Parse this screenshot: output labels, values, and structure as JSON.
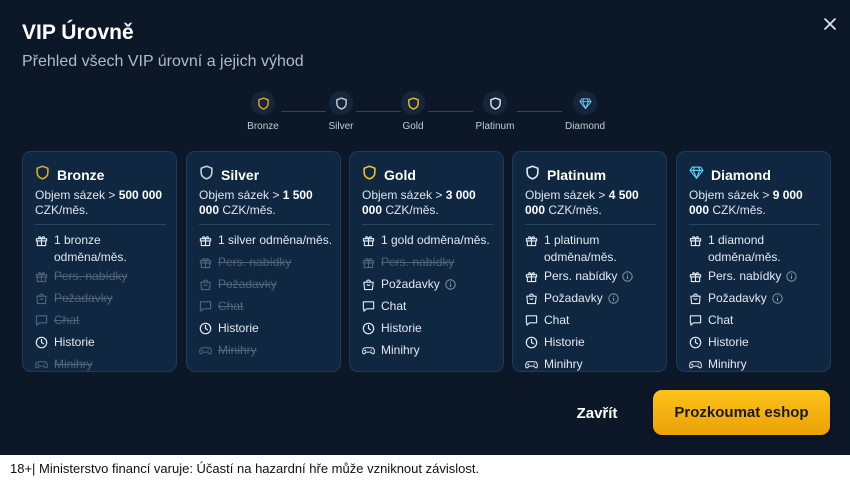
{
  "modal": {
    "title": "VIP Úrovně",
    "subtitle": "Přehled všech VIP úrovní a jejich výhod",
    "close_icon": "close-icon"
  },
  "stepper": [
    {
      "label": "Bronze",
      "icon": "shield-icon",
      "color": "#e0a526"
    },
    {
      "label": "Silver",
      "icon": "shield-icon",
      "color": "#c9ced6"
    },
    {
      "label": "Gold",
      "icon": "shield-icon",
      "color": "#f2c21b"
    },
    {
      "label": "Platinum",
      "icon": "shield-icon",
      "color": "#e3e7ec"
    },
    {
      "label": "Diamond",
      "icon": "diamond-icon",
      "color": "#5ec8f2"
    }
  ],
  "tiers": [
    {
      "name": "Bronze",
      "icon": "shield-icon",
      "color": "#e0a526",
      "req_prefix": "Objem sázek > ",
      "req_value": "500 000",
      "req_suffix": " CZK/měs.",
      "features": [
        {
          "label": "1 bronze odměna/měs.",
          "icon": "gift-icon",
          "enabled": true,
          "info": false
        },
        {
          "label": "Pers. nabídky",
          "icon": "gift-icon",
          "enabled": false,
          "info": false
        },
        {
          "label": "Požadavky",
          "icon": "bag-icon",
          "enabled": false,
          "info": false
        },
        {
          "label": "Chat",
          "icon": "chat-icon",
          "enabled": false,
          "info": false
        },
        {
          "label": "Historie",
          "icon": "clock-icon",
          "enabled": true,
          "info": false
        },
        {
          "label": "Minihry",
          "icon": "gamepad-icon",
          "enabled": false,
          "info": false
        }
      ]
    },
    {
      "name": "Silver",
      "icon": "shield-icon",
      "color": "#c9ced6",
      "req_prefix": "Objem sázek > ",
      "req_value": "1 500 000",
      "req_suffix": " CZK/měs.",
      "features": [
        {
          "label": "1 silver odměna/měs.",
          "icon": "gift-icon",
          "enabled": true,
          "info": false
        },
        {
          "label": "Pers. nabídky",
          "icon": "gift-icon",
          "enabled": false,
          "info": false
        },
        {
          "label": "Požadavky",
          "icon": "bag-icon",
          "enabled": false,
          "info": false
        },
        {
          "label": "Chat",
          "icon": "chat-icon",
          "enabled": false,
          "info": false
        },
        {
          "label": "Historie",
          "icon": "clock-icon",
          "enabled": true,
          "info": false
        },
        {
          "label": "Minihry",
          "icon": "gamepad-icon",
          "enabled": false,
          "info": false
        }
      ]
    },
    {
      "name": "Gold",
      "icon": "shield-icon",
      "color": "#f2c21b",
      "req_prefix": "Objem sázek > ",
      "req_value": "3 000 000",
      "req_suffix": " CZK/měs.",
      "features": [
        {
          "label": "1 gold odměna/měs.",
          "icon": "gift-icon",
          "enabled": true,
          "info": false
        },
        {
          "label": "Pers. nabídky",
          "icon": "gift-icon",
          "enabled": false,
          "info": false
        },
        {
          "label": "Požadavky",
          "icon": "bag-icon",
          "enabled": true,
          "info": true
        },
        {
          "label": "Chat",
          "icon": "chat-icon",
          "enabled": true,
          "info": false
        },
        {
          "label": "Historie",
          "icon": "clock-icon",
          "enabled": true,
          "info": false
        },
        {
          "label": "Minihry",
          "icon": "gamepad-icon",
          "enabled": true,
          "info": false
        }
      ]
    },
    {
      "name": "Platinum",
      "icon": "shield-icon",
      "color": "#e3e7ec",
      "req_prefix": "Objem sázek > ",
      "req_value": "4 500 000",
      "req_suffix": " CZK/měs.",
      "features": [
        {
          "label": "1 platinum odměna/měs.",
          "icon": "gift-icon",
          "enabled": true,
          "info": false
        },
        {
          "label": "Pers. nabídky",
          "icon": "gift-icon",
          "enabled": true,
          "info": true
        },
        {
          "label": "Požadavky",
          "icon": "bag-icon",
          "enabled": true,
          "info": true
        },
        {
          "label": "Chat",
          "icon": "chat-icon",
          "enabled": true,
          "info": false
        },
        {
          "label": "Historie",
          "icon": "clock-icon",
          "enabled": true,
          "info": false
        },
        {
          "label": "Minihry",
          "icon": "gamepad-icon",
          "enabled": true,
          "info": false
        }
      ]
    },
    {
      "name": "Diamond",
      "icon": "diamond-icon",
      "color": "#5ec8f2",
      "req_prefix": "Objem sázek > ",
      "req_value": "9 000 000",
      "req_suffix": " CZK/měs.",
      "features": [
        {
          "label": "1 diamond odměna/měs.",
          "icon": "gift-icon",
          "enabled": true,
          "info": false
        },
        {
          "label": "Pers. nabídky",
          "icon": "gift-icon",
          "enabled": true,
          "info": true
        },
        {
          "label": "Požadavky",
          "icon": "bag-icon",
          "enabled": true,
          "info": true
        },
        {
          "label": "Chat",
          "icon": "chat-icon",
          "enabled": true,
          "info": false
        },
        {
          "label": "Historie",
          "icon": "clock-icon",
          "enabled": true,
          "info": false
        },
        {
          "label": "Minihry",
          "icon": "gamepad-icon",
          "enabled": true,
          "info": false
        }
      ]
    }
  ],
  "actions": {
    "close_label": "Zavřít",
    "shop_label": "Prozkoumat eshop",
    "shop_color": "#f5b30f"
  },
  "footer": {
    "text": "18+| Ministerstvo financí varuje: Účastí na hazardní hře může vzniknout závislost."
  }
}
